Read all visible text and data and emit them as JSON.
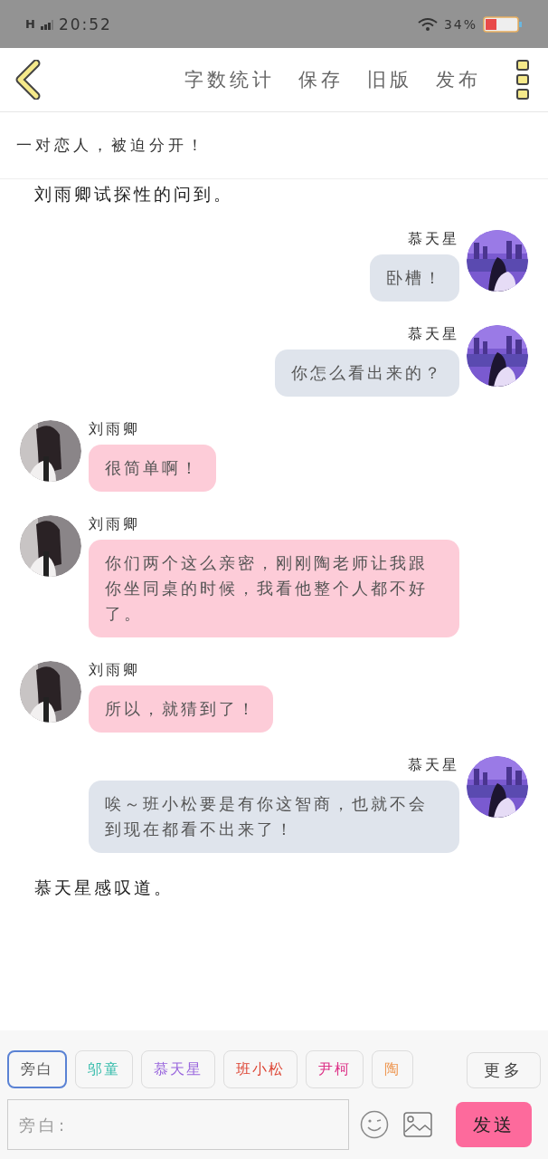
{
  "status_bar": {
    "network": "H",
    "time": "20:52",
    "battery_text": "34%"
  },
  "header": {
    "actions": [
      "字数统计",
      "保存",
      "旧版",
      "发布"
    ]
  },
  "chapter_title": "一对恋人，被迫分开！",
  "messages": [
    {
      "kind": "narration",
      "text": "刘雨卿试探性的问到。"
    },
    {
      "kind": "right",
      "name": "慕天星",
      "text": "卧槽！"
    },
    {
      "kind": "right",
      "name": "慕天星",
      "text": "你怎么看出来的？"
    },
    {
      "kind": "left",
      "name": "刘雨卿",
      "text": "很简单啊！"
    },
    {
      "kind": "left",
      "name": "刘雨卿",
      "text": "你们两个这么亲密，刚刚陶老师让我跟你坐同桌的时候，我看他整个人都不好了。"
    },
    {
      "kind": "left",
      "name": "刘雨卿",
      "text": "所以，就猜到了！"
    },
    {
      "kind": "right",
      "name": "慕天星",
      "text": "唉～班小松要是有你这智商，也就不会到现在都看不出来了！"
    },
    {
      "kind": "narration",
      "text": "慕天星感叹道。"
    }
  ],
  "characters": [
    {
      "label": "旁白",
      "color": "#555555",
      "selected": true
    },
    {
      "label": "邬童",
      "color": "#33bbaa",
      "selected": false
    },
    {
      "label": "慕天星",
      "color": "#9966dd",
      "selected": false
    },
    {
      "label": "班小松",
      "color": "#dd4433",
      "selected": false
    },
    {
      "label": "尹柯",
      "color": "#dd3388",
      "selected": false
    },
    {
      "label": "陶",
      "color": "#ee9955",
      "selected": false
    }
  ],
  "more_button": "更多",
  "input": {
    "placeholder": "旁白:"
  },
  "send_button": "发送"
}
